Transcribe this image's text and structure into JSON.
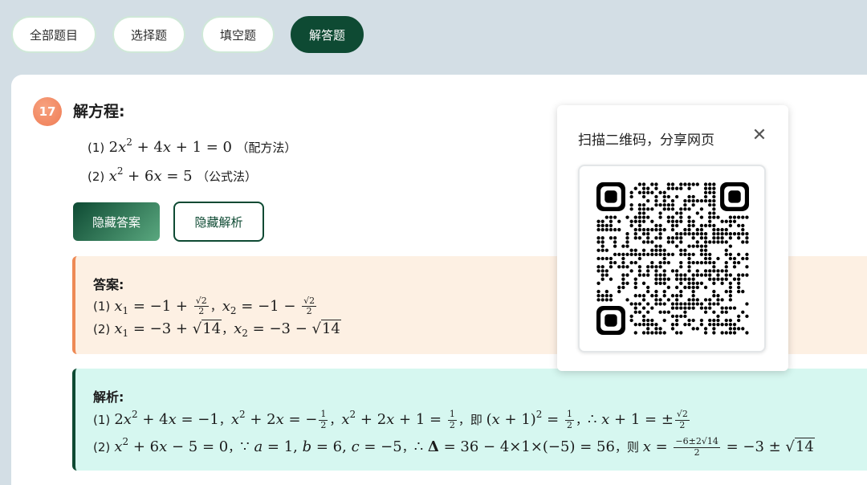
{
  "filters": [
    {
      "label": "全部题目",
      "active": false
    },
    {
      "label": "选择题",
      "active": false
    },
    {
      "label": "填空题",
      "active": false
    },
    {
      "label": "解答题",
      "active": true
    }
  ],
  "question": {
    "number": "17",
    "title": "解方程:",
    "items": [
      {
        "prefix": "(1)",
        "method": "（配方法）"
      },
      {
        "prefix": "(2)",
        "method": "（公式法）"
      }
    ]
  },
  "buttons": {
    "hide_answer": "隐藏答案",
    "hide_analysis": "隐藏解析"
  },
  "answer": {
    "title": "答案:",
    "line1_prefix": "(1)",
    "line2_prefix": "(2)"
  },
  "analysis": {
    "title": "解析:",
    "line1_prefix": "(1)",
    "line2_prefix": "(2)"
  },
  "share": {
    "title": "扫描二维码，分享网页",
    "close_icon": "close-icon",
    "qr_icon": "qr-code"
  },
  "colors": {
    "brand_green": "#0e4a33",
    "accent_orange": "#ee8a55",
    "answer_bg": "#fdf0e3",
    "analysis_bg": "#d6f7f0",
    "page_bg": "#d3dee5"
  }
}
